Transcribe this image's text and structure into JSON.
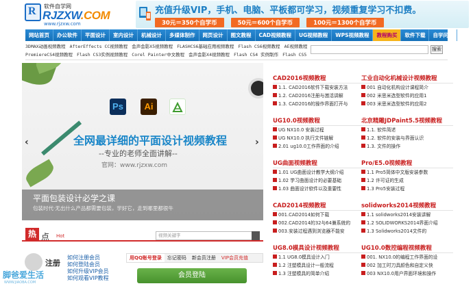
{
  "header": {
    "logo_top": "软件自学网",
    "logo_main": "RJZXW",
    "logo_dot": ".COM",
    "logo_url": "www.rjzxw.com",
    "promo_headline": "充值升级VIP，手机、电脑、平板都可学习，视频重复学习不扣费。",
    "prices": [
      "30元＝350个自学币",
      "50元＝600个自学币",
      "100元＝1300个自学币"
    ]
  },
  "nav": [
    {
      "label": "网站首页",
      "hot": false
    },
    {
      "label": "办公软件",
      "hot": false
    },
    {
      "label": "平面设计",
      "hot": false
    },
    {
      "label": "室内设计",
      "hot": false
    },
    {
      "label": "机械设计",
      "hot": false
    },
    {
      "label": "多媒体制作",
      "hot": false
    },
    {
      "label": "网页设计",
      "hot": false
    },
    {
      "label": "图文教程",
      "hot": false
    },
    {
      "label": "CAD视频教程",
      "hot": false
    },
    {
      "label": "UG视频教程",
      "hot": false
    },
    {
      "label": "WPS视频教程",
      "hot": false
    },
    {
      "label": "教程购买",
      "hot": true
    },
    {
      "label": "软件下载",
      "hot": false
    },
    {
      "label": "自学问吧",
      "hot": false
    }
  ],
  "sublinks": {
    "row1": [
      "3DMAX动画视频教程",
      "AfterEffects CC视频教程",
      "会声会影X5视频教程",
      "FLASHCS6基础应用视频教程",
      "Flash CS6视频教程",
      "AE视频教程"
    ],
    "row2": [
      "PremiereCS4视频教程",
      "Flash CS3实例视频教程",
      "Corel Painter中文教程",
      "会声会影X4视频教程",
      "Flash CS4 实例制作",
      "Flash CS5"
    ],
    "search_button": "搜索"
  },
  "banner": {
    "title": "全网最详细的平面设计视频教程",
    "subtitle": "--专业的老师全面讲解--",
    "url_text": "官网：www.rjzxw.com",
    "caption_title": "平面包装设计必学之课",
    "caption_text": "包装时代·无出什么产品都需要包装，学好它，走到哪里都很牛",
    "app_icons": [
      "Ps",
      "Ai",
      "CorelDRAW-icon"
    ],
    "prev_arrow": "‹",
    "next_arrow": "›"
  },
  "hot": {
    "badge": "热",
    "label": "点",
    "en": "Hot",
    "search_placeholder": "视频关键字"
  },
  "register": {
    "label": "注册",
    "links": [
      "如何注册会员",
      "如何登陆会员",
      "如何升级VIP会员",
      "如何观看VIP教程"
    ]
  },
  "login": {
    "tabs": [
      "用QQ账号登录",
      "忘记密码",
      "新会员注册",
      "VIP会员充值"
    ],
    "button": "会员登陆"
  },
  "watermark": {
    "text": "脚爸爱生活",
    "url": "WWW.JIAOBA.COM"
  },
  "columns": [
    {
      "title": "CAD2016视频教程",
      "items": [
        "1.1. CAD2016软件下载安装方法",
        "1.2. CAD2016注册与激活讲解",
        "1.3. CAD2016的操作界面打开与"
      ]
    },
    {
      "title": "工业自动化机械设计视频教程",
      "items": [
        "001 自动化机构设计课程简介",
        "002 米思米选型软件的应用1",
        "003 米思米选型软件的应用2"
      ]
    },
    {
      "title": "UG10.0视频教程",
      "items": [
        "UG NX10.0 安装过程",
        "UG NX10.0 执行文件链解",
        "2.01 ug10.0工作界面的介绍"
      ]
    },
    {
      "title": "北京精雕JDPaint5.5视频教程",
      "items": [
        "1.1. 软件简述",
        "1.2. 软件的安装与界面认识",
        "1.3. 文件的操作"
      ]
    },
    {
      "title": "UG曲面视频教程",
      "items": [
        "1.01 UG曲面设计教学大纲介绍",
        "1.02 学习曲面设计的必要基础",
        "1.03 曲面设计软件以及重要性"
      ]
    },
    {
      "title": "Pro/E5.0视频教程",
      "items": [
        "1.1 Pro5简体中文版安装参数",
        "1.2 许可证的生成",
        "1.3 Pro5安装过程"
      ]
    },
    {
      "title": "CAD2014视频教程",
      "items": [
        "001.CAD2014如何下载",
        "002.CAD2014的32与64兼系统的",
        "003.安装过程遇到浏览器不能安"
      ]
    },
    {
      "title": "solidworks2014视频教程",
      "items": [
        "1.1 solidworks2014安装讲解",
        "1.2 SOLIDWORKS2014界面介绍",
        "1.3 Solidworks2014文件的"
      ]
    },
    {
      "title": "UG8.0模具设计视频教程",
      "items": [
        "1.1 UG8.0模具设计入门",
        "1.2 注塑模具设计一般流程",
        "1.3 注塑模具的简单介绍"
      ]
    },
    {
      "title": "UG10.0数控编程视频教程",
      "items": [
        "001. NX10.0的编程工作界面的设",
        "002 加工时刀具颜色和自定义快",
        "003 NX10.0用户界面环境和操作"
      ]
    }
  ]
}
